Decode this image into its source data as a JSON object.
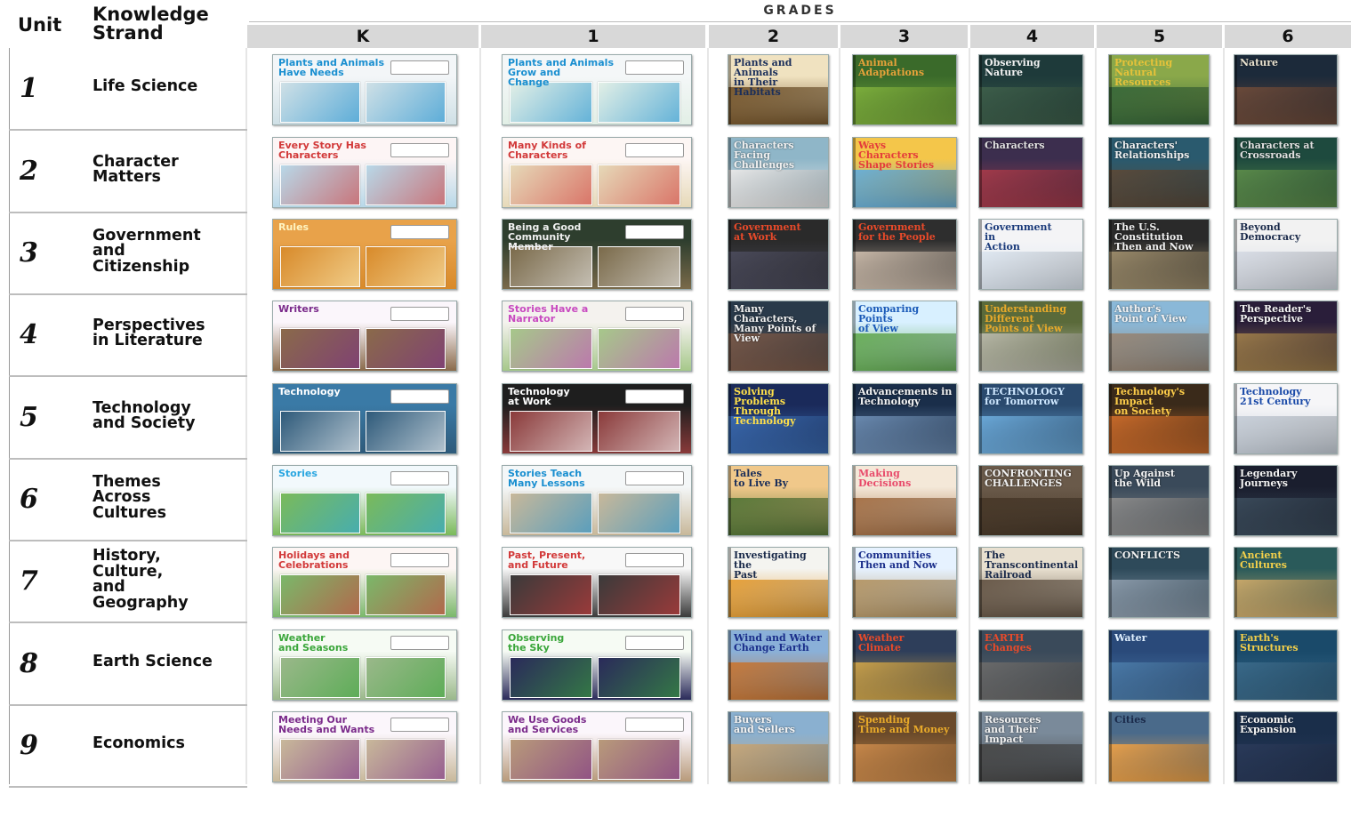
{
  "header": {
    "unit_label": "Unit",
    "strand_label_1": "Knowledge",
    "strand_label_2": "Strand",
    "grades_title": "GRADES",
    "grades": [
      "K",
      "1",
      "2",
      "3",
      "4",
      "5",
      "6"
    ]
  },
  "units": [
    {
      "num": "1",
      "strand": [
        "Life Science"
      ],
      "covers": [
        "Plants and Animals\nHave Needs",
        "Plants and Animals\nGrow and\nChange",
        "Plants and Animals\nin Their Habitats",
        "Animal\nAdaptations",
        "Observing\nNature",
        "Protecting\nNatural Resources",
        "Nature"
      ]
    },
    {
      "num": "2",
      "strand": [
        "Character",
        "Matters"
      ],
      "covers": [
        "Every Story Has\nCharacters",
        "Many Kinds of\nCharacters",
        "Characters Facing\nChallenges",
        "Ways\nCharacters\nShape Stories",
        "Characters",
        "Characters'\nRelationships",
        "Characters at\nCrossroads"
      ]
    },
    {
      "num": "3",
      "strand": [
        "Government",
        "and",
        "Citizenship"
      ],
      "covers": [
        "Rules",
        "Being a Good\nCommunity\nMember",
        "Government\nat Work",
        "Government\nfor the People",
        "Government\nin\nAction",
        "The U.S. Constitution\nThen and Now",
        "Beyond\nDemocracy"
      ]
    },
    {
      "num": "4",
      "strand": [
        "Perspectives",
        "in Literature"
      ],
      "covers": [
        "Writers",
        "Stories Have a\nNarrator",
        "Many Characters,\nMany Points of View",
        "Comparing\nPoints\nof View",
        "Understanding Different\nPoints of View",
        "Author's\nPoint of View",
        "The Reader's\nPerspective"
      ]
    },
    {
      "num": "5",
      "strand": [
        "Technology",
        "and Society"
      ],
      "covers": [
        "Technology",
        "Technology\nat Work",
        "Solving Problems\nThrough\nTechnology",
        "Advancements in\nTechnology",
        "TECHNOLOGY\nfor Tomorrow",
        "Technology's\nImpact\non Society",
        "Technology\n21st Century"
      ]
    },
    {
      "num": "6",
      "strand": [
        "Themes",
        "Across",
        "Cultures"
      ],
      "covers": [
        "Stories",
        "Stories Teach\nMany Lessons",
        "Tales\nto Live By",
        "Making\nDecisions",
        "CONFRONTING\nCHALLENGES",
        "Up Against\nthe Wild",
        "Legendary\nJourneys"
      ]
    },
    {
      "num": "7",
      "strand": [
        "History,",
        "Culture,",
        "and",
        "Geography"
      ],
      "covers": [
        "Holidays and\nCelebrations",
        "Past, Present,\nand Future",
        "Investigating\nthe\nPast",
        "Communities\nThen and Now",
        "The Transcontinental\nRailroad",
        "CONFLICTS",
        "Ancient\nCultures"
      ]
    },
    {
      "num": "8",
      "strand": [
        "Earth Science"
      ],
      "covers": [
        "Weather\nand Seasons",
        "Observing\nthe Sky",
        "Wind and Water\nChange Earth",
        "Weather\nClimate",
        "EARTH\nChanges",
        "Water",
        "Earth's\nStructures"
      ]
    },
    {
      "num": "9",
      "strand": [
        "Economics"
      ],
      "covers": [
        "Meeting Our\nNeeds and Wants",
        "We Use Goods\nand Services",
        "Buyers\nand Sellers",
        "Spending\nTime and Money",
        "Resources\nand Their\nImpact",
        "Cities",
        "Economic\nExpansion"
      ]
    }
  ],
  "colors": {
    "grade_header_bg": "#d8d8d8",
    "row_rule": "#bdbdbd"
  }
}
